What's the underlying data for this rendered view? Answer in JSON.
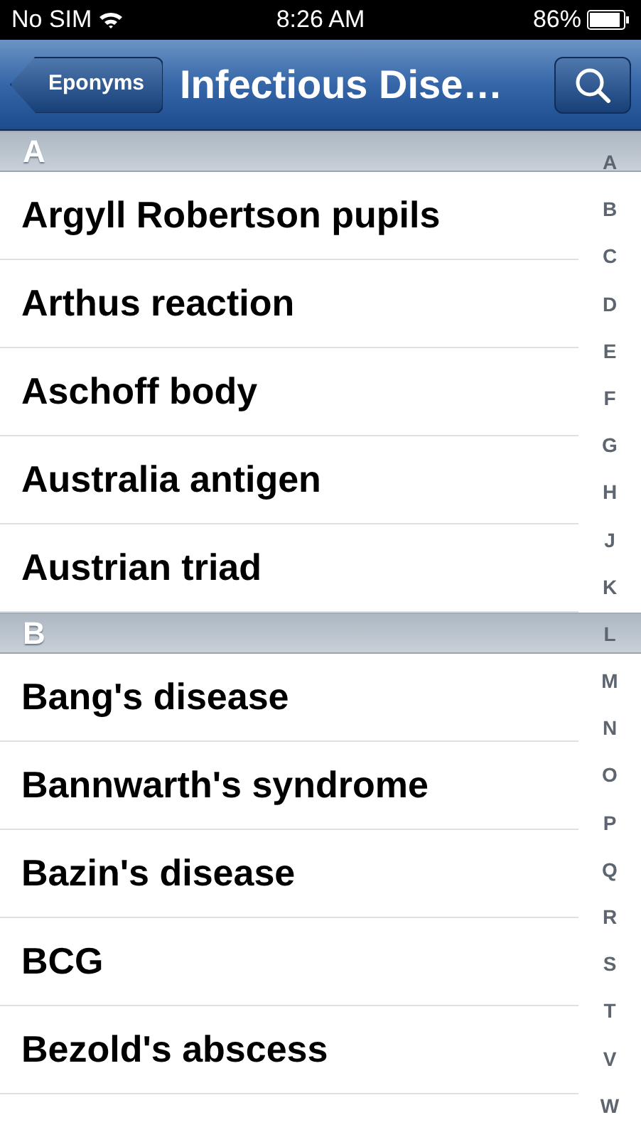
{
  "status_bar": {
    "carrier": "No SIM",
    "time": "8:26 AM",
    "battery": "86%"
  },
  "nav_bar": {
    "back_button": "Eponyms",
    "title": "Infectious Dise…"
  },
  "sections": [
    {
      "header": "A",
      "rows": [
        "Argyll Robertson pupils",
        "Arthus reaction",
        "Aschoff body",
        "Australia antigen",
        "Austrian triad"
      ]
    },
    {
      "header": "B",
      "rows": [
        "Bang's disease",
        "Bannwarth's syndrome",
        "Bazin's disease",
        "BCG",
        "Bezold's abscess"
      ]
    }
  ],
  "index": [
    "A",
    "B",
    "C",
    "D",
    "E",
    "F",
    "G",
    "H",
    "J",
    "K",
    "L",
    "M",
    "N",
    "O",
    "P",
    "Q",
    "R",
    "S",
    "T",
    "V",
    "W"
  ]
}
